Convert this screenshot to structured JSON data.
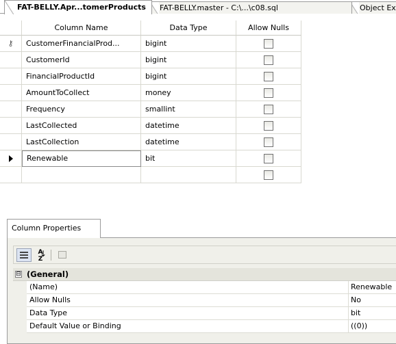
{
  "tabs": [
    {
      "label": "FAT-BELLY.Apr...tomerProducts",
      "active": true
    },
    {
      "label": "FAT-BELLY.master - C:\\...\\c08.sql",
      "active": false
    },
    {
      "label": "Object Ex",
      "active": false
    }
  ],
  "grid": {
    "headers": {
      "column_name": "Column Name",
      "data_type": "Data Type",
      "allow_nulls": "Allow Nulls"
    },
    "rows": [
      {
        "name": "CustomerFinancialProd...",
        "type": "bigint",
        "allow_nulls": false,
        "indicator": "key-icon"
      },
      {
        "name": "CustomerId",
        "type": "bigint",
        "allow_nulls": false,
        "indicator": ""
      },
      {
        "name": "FinancialProductId",
        "type": "bigint",
        "allow_nulls": false,
        "indicator": ""
      },
      {
        "name": "AmountToCollect",
        "type": "money",
        "allow_nulls": false,
        "indicator": ""
      },
      {
        "name": "Frequency",
        "type": "smallint",
        "allow_nulls": false,
        "indicator": ""
      },
      {
        "name": "LastCollected",
        "type": "datetime",
        "allow_nulls": false,
        "indicator": ""
      },
      {
        "name": "LastCollection",
        "type": "datetime",
        "allow_nulls": false,
        "indicator": ""
      },
      {
        "name": "Renewable",
        "type": "bit",
        "allow_nulls": false,
        "indicator": "current-row-arrow-icon"
      },
      {
        "name": "",
        "type": "",
        "allow_nulls": false,
        "indicator": ""
      }
    ]
  },
  "properties": {
    "tab_label": "Column Properties",
    "toolbar": [
      "categorized-icon",
      "sort-alphabetical-icon",
      "property-pages-icon"
    ],
    "category": {
      "expander": "⊟",
      "label": "(General)"
    },
    "rows": [
      {
        "name": "(Name)",
        "value": "Renewable"
      },
      {
        "name": "Allow Nulls",
        "value": "No"
      },
      {
        "name": "Data Type",
        "value": "bit"
      },
      {
        "name": "Default Value or Binding",
        "value": "((0))"
      }
    ]
  }
}
